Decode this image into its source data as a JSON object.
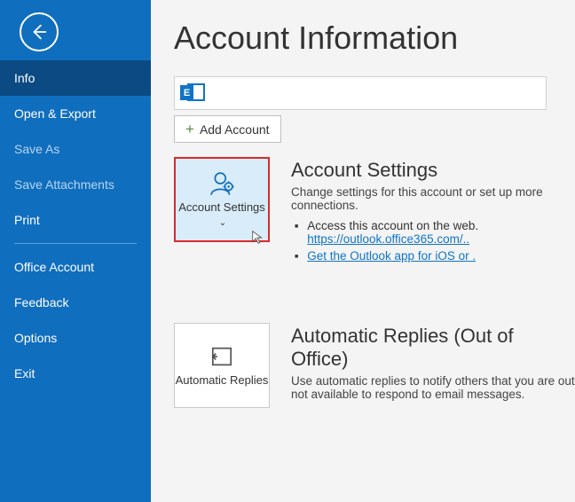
{
  "sidebar": {
    "items": [
      {
        "label": "Info",
        "selected": true
      },
      {
        "label": "Open & Export"
      },
      {
        "label": "Save As",
        "muted": true
      },
      {
        "label": "Save Attachments",
        "muted": true
      },
      {
        "label": "Print"
      }
    ],
    "footerItems": [
      {
        "label": "Office Account"
      },
      {
        "label": "Feedback"
      },
      {
        "label": "Options"
      },
      {
        "label": "Exit"
      }
    ]
  },
  "main": {
    "title": "Account Information",
    "exchangeGlyph": "E",
    "addAccount": "Add Account",
    "accountSettings": {
      "tileLabel": "Account Settings",
      "heading": "Account Settings",
      "desc": "Change settings for this account or set up more connections.",
      "bullet1_pre": "Access this account on the web.",
      "bullet1_link": "https://outlook.office365.com/..",
      "bullet2_link": "Get the Outlook app for iOS or ."
    },
    "autoReplies": {
      "tileLabel": "Automatic Replies",
      "heading": "Automatic Replies (Out of Office)",
      "desc": "Use automatic replies to notify others that you are out not available to respond to email messages."
    }
  }
}
